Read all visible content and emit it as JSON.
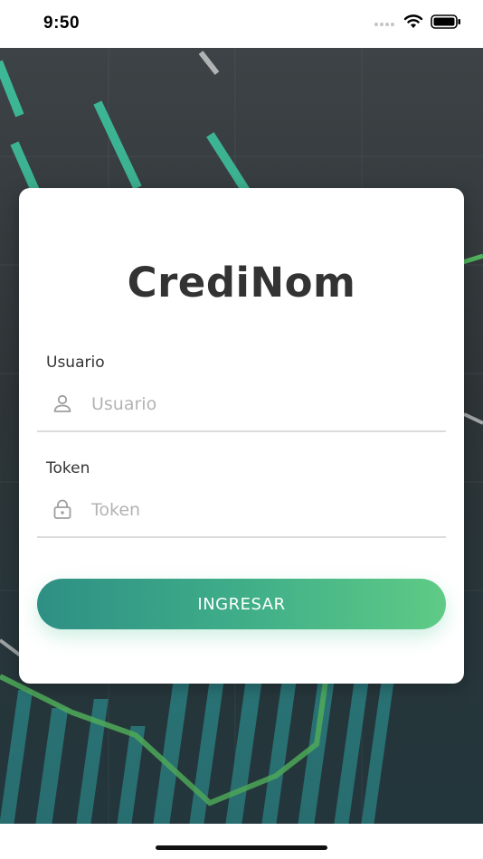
{
  "status_bar": {
    "time": "9:50",
    "wifi_icon": "wifi-icon",
    "battery_icon": "battery-icon"
  },
  "app": {
    "title": "CrediNom"
  },
  "form": {
    "username": {
      "label": "Usuario",
      "placeholder": "Usuario",
      "value": "",
      "icon": "user-icon"
    },
    "token": {
      "label": "Token",
      "placeholder": "Token",
      "value": "",
      "icon": "lock-icon"
    },
    "submit_label": "INGRESAR"
  },
  "colors": {
    "button_gradient_start": "#2e8f84",
    "button_gradient_end": "#5fcb86",
    "title": "#333333",
    "placeholder": "#b3b3b3",
    "background_chart_green": "#3ecfa6"
  }
}
